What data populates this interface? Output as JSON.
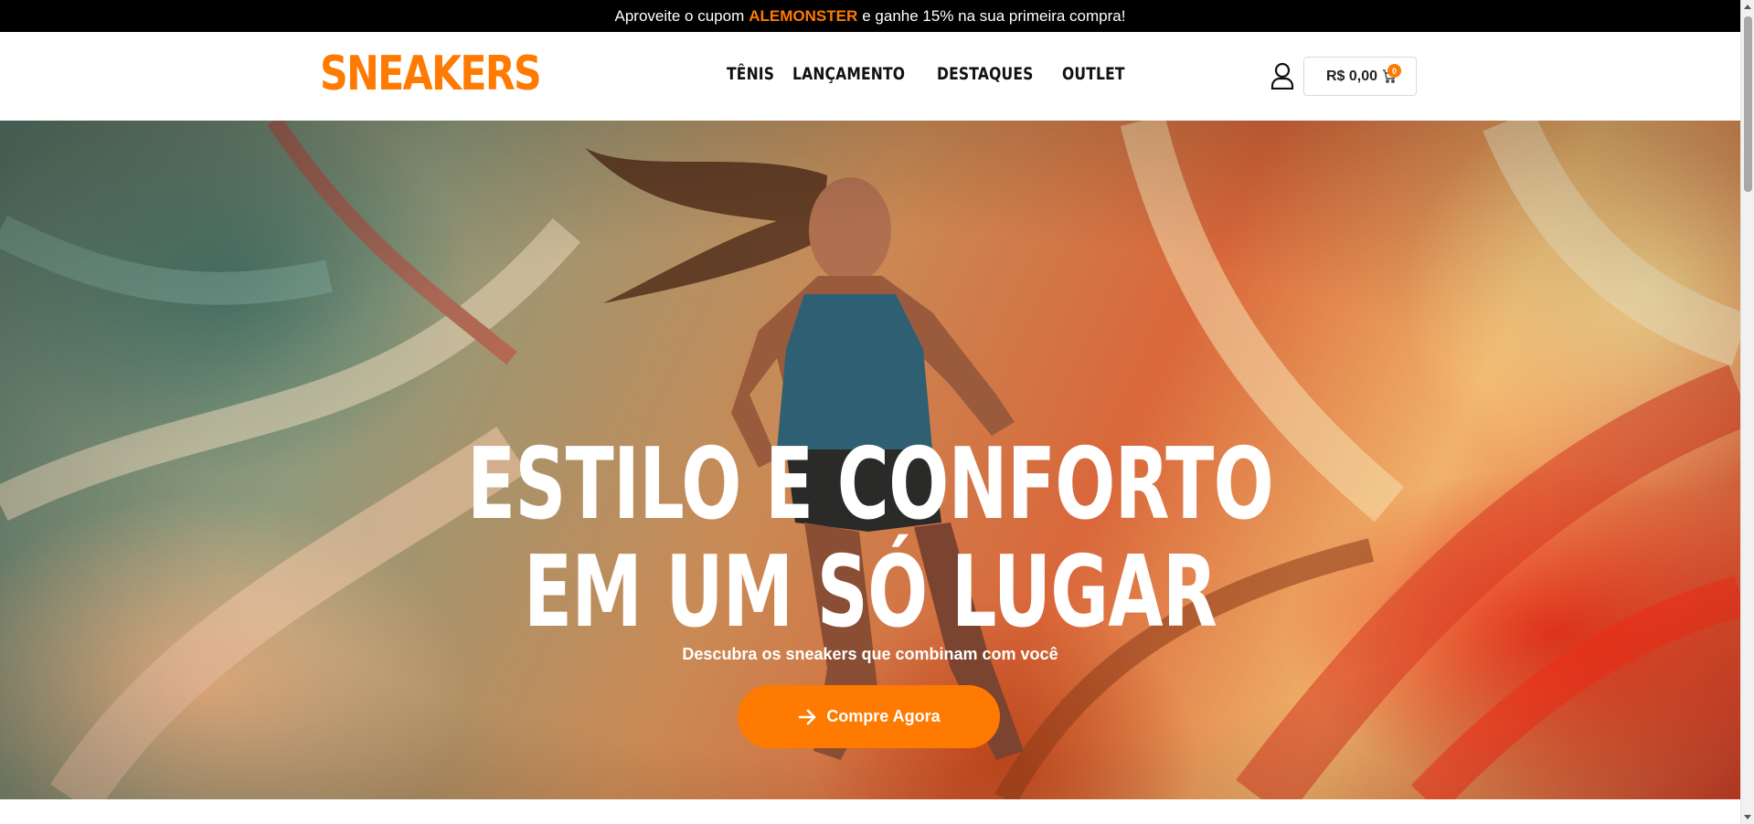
{
  "announcement": {
    "prefix": "Aproveite o cupom",
    "coupon": "ALEMONSTER",
    "suffix": "e ganhe 15% na sua primeira compra!"
  },
  "header": {
    "logo": "SNEAKERS",
    "nav": [
      "TÊNIS",
      "LANÇAMENTO",
      "DESTAQUES",
      "OUTLET"
    ],
    "account_icon": "user-icon",
    "cart": {
      "amount": "R$ 0,00",
      "count": "0",
      "icon": "cart-icon"
    }
  },
  "hero": {
    "title_line_1": "ESTILO E CONFORTO",
    "title_line_2": "EM UM SÓ LUGAR",
    "subtitle": "Descubra os sneakers que combinam com você",
    "cta_label": "Compre Agora",
    "cta_icon": "arrow-right-icon"
  },
  "colors": {
    "accent": "#ff7a00",
    "announcement_bg": "#000000",
    "text_dark": "#111111"
  }
}
